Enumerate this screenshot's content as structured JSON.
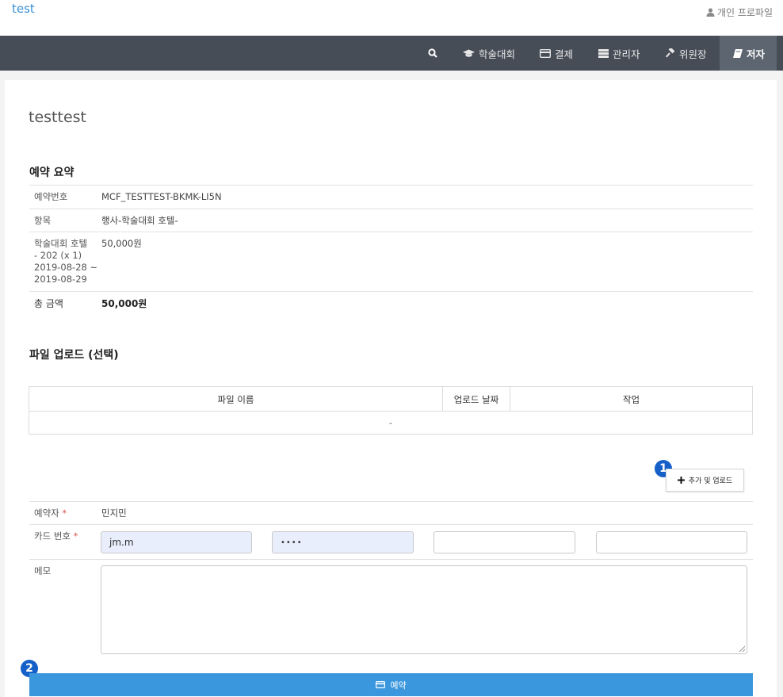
{
  "header": {
    "brand": "test",
    "profile_label": "개인 프로파일"
  },
  "nav": {
    "items": [
      {
        "label": "",
        "icon": "search-icon"
      },
      {
        "label": "학술대회",
        "icon": "graduation-cap-icon"
      },
      {
        "label": "결제",
        "icon": "credit-card-icon"
      },
      {
        "label": "관리자",
        "icon": "server-icon"
      },
      {
        "label": "위원장",
        "icon": "gavel-icon"
      },
      {
        "label": "저자",
        "icon": "book-icon",
        "active": true
      }
    ]
  },
  "page": {
    "title": "testtest"
  },
  "summary": {
    "title": "예약 요약",
    "rows": [
      {
        "label": "예약번호",
        "value": "MCF_TESTTEST-BKMK-LI5N"
      },
      {
        "label": "항목",
        "value": "행사-학술대회 호텔-"
      },
      {
        "label_lines": [
          "학술대회 호텔",
          "- 202 (x 1)",
          "2019-08-28 ~",
          "2019-08-29"
        ],
        "value": "50,000원"
      },
      {
        "label": "총 금액",
        "value": "50,000원"
      }
    ]
  },
  "files": {
    "title": "파일 업로드 (선택)",
    "columns": [
      "파일 이름",
      "업로드 날짜",
      "작업"
    ],
    "empty": "-",
    "add_button": "추가 및 업로드"
  },
  "form": {
    "booker_label": "예약자",
    "booker_value": "민지민",
    "card_label": "카드 번호",
    "card_fields": [
      "jm.m",
      "••••",
      "",
      ""
    ],
    "memo_label": "메모",
    "required_mark": "*"
  },
  "badges": [
    "1",
    "2"
  ],
  "submit_label": "예약",
  "colors": {
    "accent": "#3a90d6",
    "navbar": "#464d57",
    "button": "#3b97dd",
    "badge": "#1560c8",
    "required": "#d9534f"
  }
}
